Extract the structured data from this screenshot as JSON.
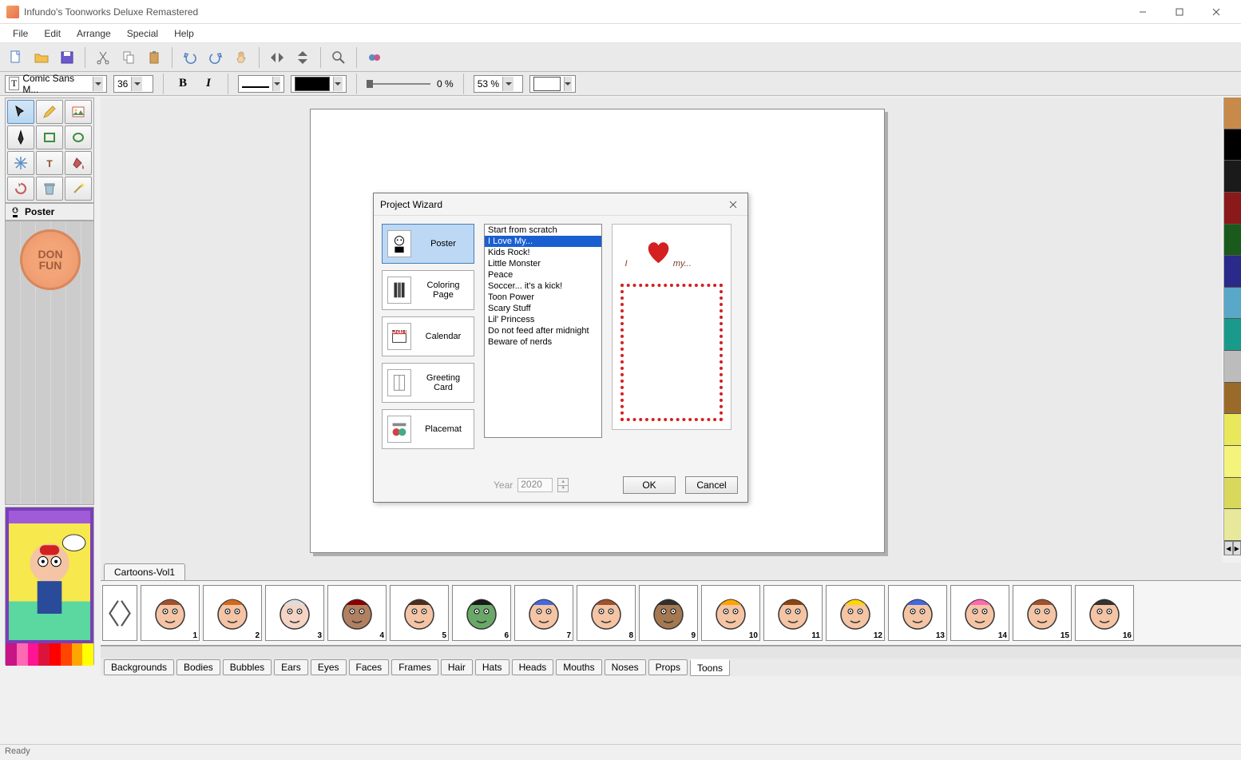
{
  "app": {
    "title": "Infundo's Toonworks Deluxe Remastered",
    "status": "Ready"
  },
  "menu": {
    "file": "File",
    "edit": "Edit",
    "arrange": "Arrange",
    "special": "Special",
    "help": "Help"
  },
  "format": {
    "font_label": "T",
    "font": "Comic Sans M...",
    "size": "36",
    "bold": "B",
    "italic": "I",
    "opacity": "0 %",
    "zoom": "53 %"
  },
  "poster": {
    "label": "Poster",
    "fun": "DON\nFUN"
  },
  "dialog": {
    "title": "Project Wizard",
    "types": [
      {
        "label": "Poster",
        "active": true
      },
      {
        "label": "Coloring Page",
        "active": false
      },
      {
        "label": "Calendar",
        "active": false
      },
      {
        "label": "Greeting Card",
        "active": false
      },
      {
        "label": "Placemat",
        "active": false
      }
    ],
    "templates": [
      "Start from scratch",
      "I Love My...",
      "Kids Rock!",
      "Little Monster",
      "Peace",
      "Soccer... it's a kick!",
      "Toon Power",
      "Scary Stuff",
      "Lil' Princess",
      "Do not feed after midnight",
      "Beware of nerds"
    ],
    "selected_template": 1,
    "year_label": "Year",
    "year": "2020",
    "ok": "OK",
    "cancel": "Cancel",
    "preview_text": "my..."
  },
  "library": {
    "tab": "Cartoons-Vol1",
    "count": 16
  },
  "categories": [
    "Backgrounds",
    "Bodies",
    "Bubbles",
    "Ears",
    "Eyes",
    "Faces",
    "Frames",
    "Hair",
    "Hats",
    "Heads",
    "Mouths",
    "Noses",
    "Props",
    "Toons"
  ],
  "active_category": "Toons",
  "colors": [
    "#c78a4a",
    "#000000",
    "#1a1a1a",
    "#8a1a1a",
    "#1a5a1a",
    "#2a2a8a",
    "#5aa8c8",
    "#1a9a8a",
    "#bcbcbc",
    "#9a6a2a",
    "#e8e85a",
    "#f4f47a",
    "#d8d85a",
    "#e8e89a"
  ],
  "palette_row": [
    "#c71585",
    "#ff69b4",
    "#ff1493",
    "#dc143c",
    "#ff0000",
    "#ff4500",
    "#ffa500",
    "#ffff00"
  ]
}
